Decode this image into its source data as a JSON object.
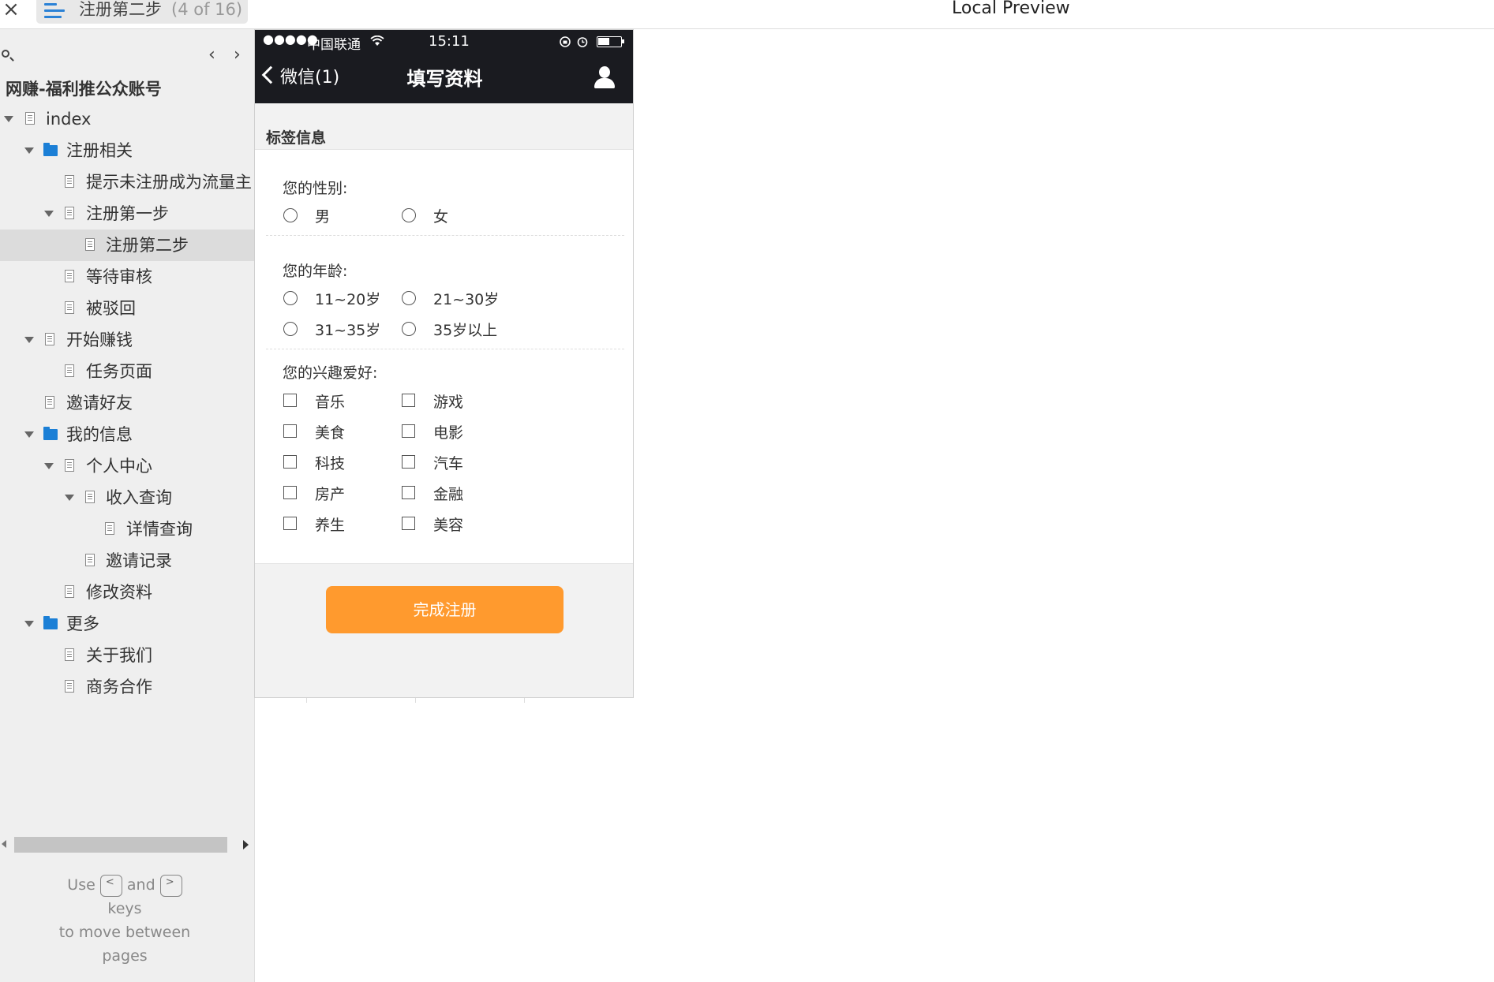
{
  "topbar": {
    "close_glyph": "×",
    "page_title": "注册第二步",
    "page_count": "(4 of 16)",
    "preview_title": "Local Preview"
  },
  "sidebar": {
    "project_name": "网赚-福利推公众账号",
    "nav_prev": "‹",
    "nav_next": "›",
    "tree": [
      {
        "label": "index",
        "type": "page",
        "expanded": true
      },
      {
        "label": "注册相关",
        "type": "folder",
        "expanded": true
      },
      {
        "label": "提示未注册成为流量主",
        "type": "page"
      },
      {
        "label": "注册第一步",
        "type": "page",
        "expanded": true
      },
      {
        "label": "注册第二步",
        "type": "page",
        "selected": true
      },
      {
        "label": "等待审核",
        "type": "page"
      },
      {
        "label": "被驳回",
        "type": "page"
      },
      {
        "label": "开始赚钱",
        "type": "page",
        "expanded": true
      },
      {
        "label": "任务页面",
        "type": "page"
      },
      {
        "label": "邀请好友",
        "type": "page"
      },
      {
        "label": "我的信息",
        "type": "folder",
        "expanded": true
      },
      {
        "label": "个人中心",
        "type": "page",
        "expanded": true
      },
      {
        "label": "收入查询",
        "type": "page",
        "expanded": true
      },
      {
        "label": "详情查询",
        "type": "page"
      },
      {
        "label": "邀请记录",
        "type": "page"
      },
      {
        "label": "修改资料",
        "type": "page"
      },
      {
        "label": "更多",
        "type": "folder",
        "expanded": true
      },
      {
        "label": "关于我们",
        "type": "page"
      },
      {
        "label": "商务合作",
        "type": "page"
      }
    ],
    "hint": {
      "use": "Use",
      "key_prev": "<",
      "and": "and",
      "key_next": ">",
      "keys": "keys",
      "line2": "to move between",
      "line3": "pages"
    }
  },
  "phone": {
    "status": {
      "signal": "●●●●●",
      "carrier": "中国联通",
      "time": "15:11"
    },
    "nav": {
      "back_label": "微信(1)",
      "title": "填写资料"
    },
    "section_title": "标签信息",
    "gender": {
      "label": "您的性别:",
      "options": [
        "男",
        "女"
      ]
    },
    "age": {
      "label": "您的年龄:",
      "options": [
        "11~20岁",
        "21~30岁",
        "31~35岁",
        "35岁以上"
      ]
    },
    "interests": {
      "label": "您的兴趣爱好:",
      "options": [
        "音乐",
        "游戏",
        "美食",
        "电影",
        "科技",
        "汽车",
        "房产",
        "金融",
        "养生",
        "美容"
      ]
    },
    "submit_label": "完成注册",
    "accent_color": "#ff9a2e",
    "header_color": "#1a1b20"
  }
}
